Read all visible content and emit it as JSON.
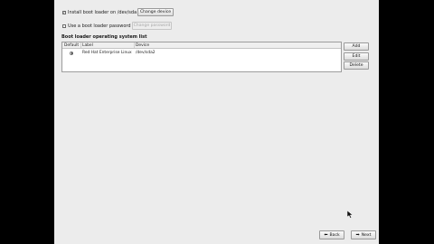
{
  "bootloader": {
    "install_label": "Install boot loader on /dev/sda",
    "install_checked": true,
    "change_device_label": "Change device",
    "password_label": "Use a boot loader password",
    "password_checked": false,
    "change_password_label": "Change password",
    "list_title": "Boot loader operating system list",
    "columns": [
      "Default",
      "Label",
      "Device"
    ],
    "rows": [
      {
        "default": true,
        "label": "Red Hat Enterprise Linux",
        "device": "/dev/sda2"
      }
    ],
    "add_label": "Add",
    "edit_label": "Edit",
    "delete_label": "Delete"
  },
  "nav": {
    "back_label": "Back",
    "next_label": "Next"
  }
}
